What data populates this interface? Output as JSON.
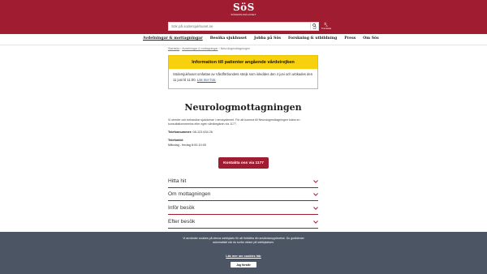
{
  "header": {
    "logo_text": "SöS",
    "logo_subtitle": "SÖDERSJUKHUSET",
    "search_placeholder": "Sök på sodersjukhuset.se",
    "search_label": "Sök",
    "translate_label": "Translate",
    "bg_color": "#a01c30"
  },
  "nav": {
    "items": [
      {
        "label": "Avdelningar & mottagningar",
        "active": true
      },
      {
        "label": "Besöka sjukhuset"
      },
      {
        "label": "Jobba på Sös"
      },
      {
        "label": "Forskning & utbildning"
      },
      {
        "label": "Press"
      },
      {
        "label": "Om Sös"
      }
    ]
  },
  "breadcrumb": {
    "link1": "Startsida",
    "link2": "Avdelningar & mottagningar",
    "current": "Neurologmottagningen"
  },
  "alert": {
    "heading": "Information till patienter angående vårdstrejken",
    "body": "Södersjukhuset omfattas av Vårdförbundets strejk som inleddes den 4 juni och utökades den 11 juni kl 11:00.",
    "link": "Läs mer här.",
    "color": "#f7d10e"
  },
  "page": {
    "title": "Neurologmottagningen",
    "intro": "Vi utreder och behandlar sjukdomar i nervsystemet. För att komma till Neurologmottagningen krävs en konsultationsremiss eller egen vårdbegäran via 1177.",
    "phone_label": "Telefonnummer:",
    "phone_value": "08-123 634 26",
    "hours_label": "Telefontid:",
    "hours_value": "Måndag - fredag 8:00-10:00",
    "cta_label": "Kontakta oss via 1177"
  },
  "accordion": {
    "items": [
      "Hitta hit",
      "Om mottagningen",
      "Inför besök",
      "Efter besök"
    ]
  },
  "cookie": {
    "text": "Vi använder cookies på denna webbplats för att förbättra din användarupplevelse. Du godkänner automatiskt när du surfar vidare på webbplatsen.",
    "link": "Läs mer om cookies här",
    "button": "Jag förstår"
  }
}
